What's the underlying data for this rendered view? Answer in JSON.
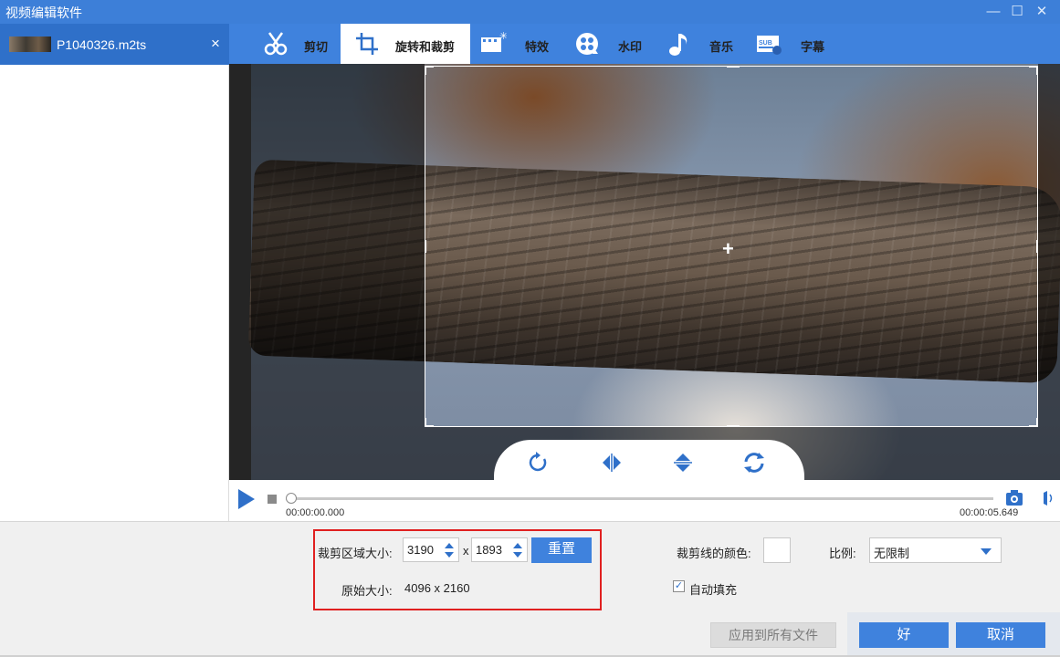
{
  "window": {
    "title": "视频编辑软件",
    "minimize": "—",
    "maximize": "☐",
    "close": "✕"
  },
  "sidebar": {
    "file_name": "P1040326.m2ts",
    "close_symbol": "×"
  },
  "toolbar": {
    "tabs": [
      {
        "label": "剪切",
        "icon": "scissors-icon",
        "active": false
      },
      {
        "label": "旋转和裁剪",
        "icon": "crop-icon",
        "active": true
      },
      {
        "label": "特效",
        "icon": "effects-icon",
        "active": false
      },
      {
        "label": "水印",
        "icon": "watermark-icon",
        "active": false
      },
      {
        "label": "音乐",
        "icon": "music-icon",
        "active": false
      },
      {
        "label": "字幕",
        "icon": "subtitle-icon",
        "active": false
      }
    ]
  },
  "preview": {
    "crosshair": "+",
    "collapse_symbol": "ˇ"
  },
  "player": {
    "time_current": "00:00:00.000",
    "time_total": "00:00:05.649",
    "progress": 0
  },
  "crop": {
    "area_label": "裁剪区域大小:",
    "width": "3190",
    "times": "x",
    "height": "1893",
    "reset_label": "重置",
    "original_label": "原始大小:",
    "original_value": "4096 x 2160",
    "line_color_label": "裁剪线的颜色:",
    "ratio_label": "比例:",
    "ratio_value": "无限制",
    "auto_fill_label": "自动填充",
    "auto_fill_checked": true
  },
  "footer": {
    "apply_all_label": "应用到所有文件",
    "ok_label": "好",
    "cancel_label": "取消"
  },
  "colors": {
    "accent": "#3f82dd",
    "titlebar": "#3d7fd8",
    "highlight_box": "#e02020"
  }
}
